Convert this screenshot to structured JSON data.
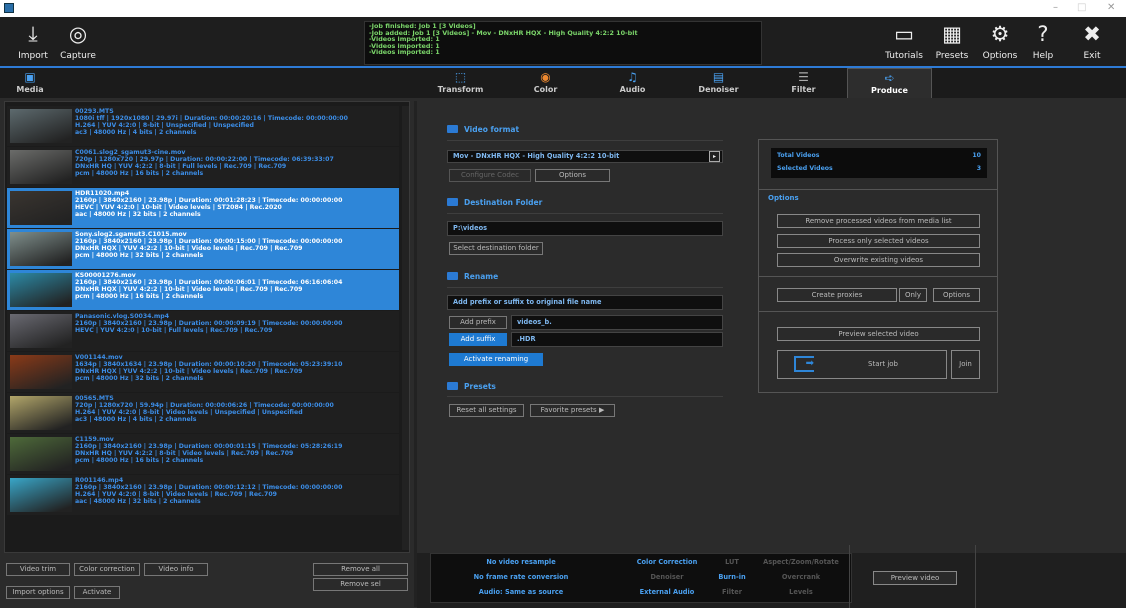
{
  "window": {
    "minimize": "–",
    "maximize": "□",
    "close": "✕"
  },
  "toolbar": {
    "import": "Import",
    "capture": "Capture",
    "tutorials": "Tutorials",
    "presets": "Presets",
    "options": "Options",
    "help": "Help",
    "exit": "Exit"
  },
  "log": [
    "-Job finished: Job 1 [3 Videos]",
    "-Job added: Job 1 [3 Videos] -  Mov - DNxHR HQX - High Quality 4:2:2 10-bit",
    "-Videos imported: 1",
    "-Videos imported: 1",
    "-Videos imported: 1"
  ],
  "tabs": {
    "media": "Media",
    "transform": "Transform",
    "color": "Color",
    "audio": "Audio",
    "denoiser": "Denoiser",
    "filter": "Filter",
    "produce": "Produce"
  },
  "media": [
    {
      "name": "00293.MTS",
      "l1": "1080i tff | 1920x1080 | 29.97i | Duration: 00:00:20:16 | Timecode: 00:00:00:00",
      "l2": "H.264 | YUV 4:2:0 | 8-bit | Unspecified | Unspecified",
      "l3": "ac3 | 48000 Hz | 4 bits | 2 channels",
      "selected": false,
      "thumb": "#5d6a6e"
    },
    {
      "name": "C0061.slog2_sgamut3-cine.mov",
      "l1": "720p | 1280x720 | 29.97p | Duration: 00:00:22:00 | Timecode: 06:39:33:07",
      "l2": "DNxHR HQ | YUV 4:2:2 | 8-bit | Full levels | Rec.709 | Rec.709",
      "l3": "pcm | 48000 Hz | 16 bits | 2 channels",
      "selected": false,
      "thumb": "#6b6c6a"
    },
    {
      "name": "HDR11020.mp4",
      "l1": "2160p | 3840x2160 | 23.98p | Duration: 00:01:28:23 | Timecode: 00:00:00:00",
      "l2": "HEVC | YUV 4:2:0 | 10-bit | Video levels | ST2084 | Rec.2020",
      "l3": "aac | 48000 Hz | 32 bits | 2 channels",
      "selected": true,
      "thumb": "#3a3530"
    },
    {
      "name": "Sony.slog2.sgamut3.C1015.mov",
      "l1": "2160p | 3840x2160 | 23.98p | Duration: 00:00:15:00 | Timecode: 00:00:00:00",
      "l2": "DNxHR HQX | YUV 4:2:2 | 10-bit | Video levels | Rec.709 | Rec.709",
      "l3": "pcm | 48000 Hz | 32 bits | 2 channels",
      "selected": true,
      "thumb": "#7f8f8c"
    },
    {
      "name": "KS00001276.mov",
      "l1": "2160p | 3840x2160 | 23.98p | Duration: 00:00:06:01 | Timecode: 06:16:06:04",
      "l2": "DNxHR HQX | YUV 4:2:2 | 10-bit | Video levels | Rec.709 | Rec.709",
      "l3": "pcm | 48000 Hz | 16 bits | 2 channels",
      "selected": true,
      "thumb": "#2c8aa6"
    },
    {
      "name": "Panasonic.vlog.S0034.mp4",
      "l1": "2160p | 3840x2160 | 23.98p | Duration: 00:00:09:19 | Timecode: 00:00:00:00",
      "l2": "HEVC | YUV 4:2:0 | 10-bit | Full levels | Rec.709 | Rec.709",
      "l3": "",
      "selected": false,
      "thumb": "#6a6a72"
    },
    {
      "name": "V001144.mov",
      "l1": "1634p | 3840x1634 | 23.98p | Duration: 00:00:10:20 | Timecode: 05:23:39:10",
      "l2": "DNxHR HQX | YUV 4:2:2 | 10-bit | Video levels | Rec.709 | Rec.709",
      "l3": "pcm | 48000 Hz | 32 bits | 2 channels",
      "selected": false,
      "thumb": "#8a3a18"
    },
    {
      "name": "00565.MTS",
      "l1": "720p | 1280x720 | 59.94p | Duration: 00:00:06:26 | Timecode: 00:00:00:00",
      "l2": "H.264 | YUV 4:2:0 | 8-bit | Video levels | Unspecified | Unspecified",
      "l3": "ac3 | 48000 Hz | 4 bits | 2 channels",
      "selected": false,
      "thumb": "#b2a66a"
    },
    {
      "name": "C1159.mov",
      "l1": "2160p | 3840x2160 | 23.98p | Duration: 00:00:01:15 | Timecode: 05:28:26:19",
      "l2": "DNxHR HQ | YUV 4:2:2 | 8-bit | Video levels | Rec.709 | Rec.709",
      "l3": "pcm | 48000 Hz | 16 bits | 2 channels",
      "selected": false,
      "thumb": "#4e6a3a"
    },
    {
      "name": "R001146.mp4",
      "l1": "2160p | 3840x2160 | 23.98p | Duration: 00:00:12:12 | Timecode: 00:00:00:00",
      "l2": "H.264 | YUV 4:2:0 | 8-bit | Video levels | Rec.709 | Rec.709",
      "l3": "aac | 48000 Hz | 32 bits | 2 channels",
      "selected": false,
      "thumb": "#39a6c8"
    }
  ],
  "leftbuttons": {
    "video_trim": "Video trim",
    "color_correction": "Color correction",
    "video_info": "Video info",
    "remove_all": "Remove all",
    "import_options": "Import options",
    "activate": "Activate",
    "remove_sel": "Remove sel"
  },
  "produce": {
    "video_format_title": "Video format",
    "format_value": "Mov - DNxHR HQX - High Quality 4:2:2 10-bit",
    "configure_codec": "Configure Codec",
    "options": "Options",
    "destination_title": "Destination Folder",
    "destination_value": "P:\\videos",
    "select_destination": "Select destination folder",
    "rename_title": "Rename",
    "rename_hint": "Add prefix or suffix to original file name",
    "add_prefix": "Add prefix",
    "prefix_value": "videos_b.",
    "add_suffix": "Add suffix",
    "suffix_value": ".HDR",
    "activate_renaming": "Activate renaming",
    "presets_title": "Presets",
    "reset_all": "Reset all settings",
    "favorite_presets": "Favorite presets"
  },
  "summary": {
    "total_label": "Total Videos",
    "total_value": "10",
    "selected_label": "Selected Videos",
    "selected_value": "3",
    "options_title": "Options",
    "remove_processed": "Remove processed videos from media list",
    "process_selected": "Process only selected videos",
    "overwrite": "Overwrite existing videos",
    "create_proxies": "Create proxies",
    "only": "Only",
    "options": "Options",
    "preview_selected": "Preview selected video",
    "start_job": "Start job",
    "join": "Join"
  },
  "bottom": {
    "no_resample": "No video resample",
    "no_frame_rate": "No frame rate conversion",
    "audio_same": "Audio: Same as source",
    "color_correction": "Color Correction",
    "denoiser": "Denoiser",
    "external_audio": "External Audio",
    "lut": "LUT",
    "burn_in": "Burn-in",
    "filter": "Filter",
    "aspect": "Aspect/Zoom/Rotate",
    "overcrank": "Overcrank",
    "levels": "Levels",
    "preview_video": "Preview video"
  },
  "colors": {
    "accent": "#2e86d8",
    "log_text": "#7bd56a",
    "active_label": "#3c8ee8",
    "inactive_label": "#555555"
  }
}
